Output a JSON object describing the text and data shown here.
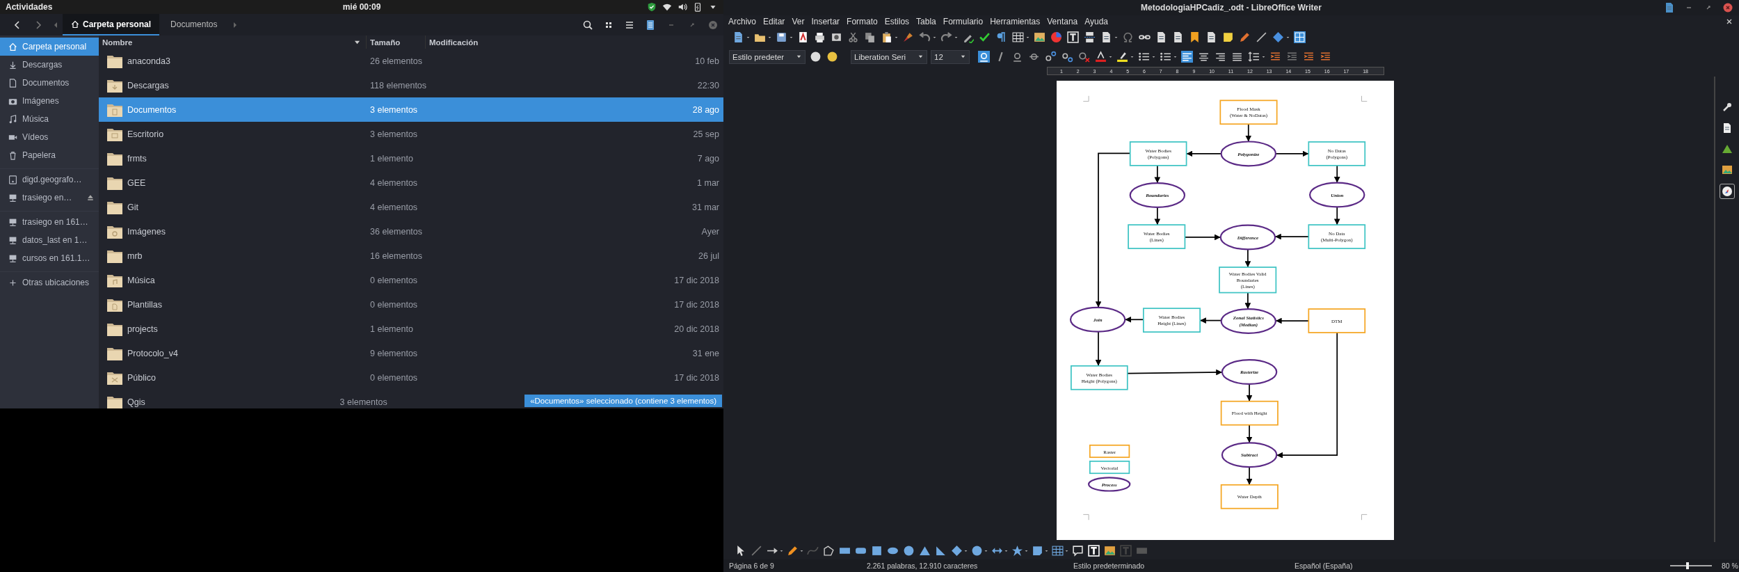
{
  "top_bar": {
    "activities": "Actividades",
    "clock": "mié 00:09"
  },
  "files": {
    "tabs": [
      {
        "label": "Carpeta personal",
        "selected": true
      },
      {
        "label": "Documentos",
        "selected": false
      }
    ],
    "sidebar": [
      {
        "items": [
          {
            "label": "Carpeta personal",
            "selected": true,
            "eject": false
          },
          {
            "label": "Descargas",
            "selected": false,
            "eject": false
          },
          {
            "label": "Documentos",
            "selected": false,
            "eject": false
          },
          {
            "label": "Imágenes",
            "selected": false,
            "eject": false
          },
          {
            "label": "Música",
            "selected": false,
            "eject": false
          },
          {
            "label": "Vídeos",
            "selected": false,
            "eject": false
          },
          {
            "label": "Papelera",
            "selected": false,
            "eject": false
          }
        ]
      },
      {
        "items": [
          {
            "label": "digd.geografo…",
            "selected": false,
            "eject": false
          },
          {
            "label": "trasiego en…",
            "selected": false,
            "eject": true
          }
        ]
      },
      {
        "items": [
          {
            "label": "trasiego en 161…",
            "selected": false,
            "eject": false
          },
          {
            "label": "datos_last en 1…",
            "selected": false,
            "eject": false
          },
          {
            "label": "cursos en 161.1…",
            "selected": false,
            "eject": false
          }
        ]
      },
      {
        "items": [
          {
            "label": "Otras ubicaciones",
            "selected": false,
            "eject": false
          }
        ]
      }
    ],
    "columns": [
      {
        "label": "Nombre",
        "sorted": true
      },
      {
        "label": "Tamaño",
        "sorted": false
      },
      {
        "label": "Modificación",
        "sorted": false
      }
    ],
    "rows": [
      {
        "name": "anaconda3",
        "size": "26 elementos",
        "modified": "10 feb",
        "selected": false
      },
      {
        "name": "Descargas",
        "size": "118 elementos",
        "modified": "22:30",
        "selected": false
      },
      {
        "name": "Documentos",
        "size": "3 elementos",
        "modified": "28 ago",
        "selected": true
      },
      {
        "name": "Escritorio",
        "size": "3 elementos",
        "modified": "25 sep",
        "selected": false
      },
      {
        "name": "frmts",
        "size": "1 elemento",
        "modified": "7 ago",
        "selected": false
      },
      {
        "name": "GEE",
        "size": "4 elementos",
        "modified": "1 mar",
        "selected": false
      },
      {
        "name": "Git",
        "size": "4 elementos",
        "modified": "31 mar",
        "selected": false
      },
      {
        "name": "Imágenes",
        "size": "36 elementos",
        "modified": "Ayer",
        "selected": false
      },
      {
        "name": "mrb",
        "size": "16 elementos",
        "modified": "26 jul",
        "selected": false
      },
      {
        "name": "Música",
        "size": "0 elementos",
        "modified": "17 dic 2018",
        "selected": false
      },
      {
        "name": "Plantillas",
        "size": "0 elementos",
        "modified": "17 dic 2018",
        "selected": false
      },
      {
        "name": "projects",
        "size": "1 elemento",
        "modified": "20 dic 2018",
        "selected": false
      },
      {
        "name": "Protocolo_v4",
        "size": "9 elementos",
        "modified": "31 ene",
        "selected": false
      },
      {
        "name": "Público",
        "size": "0 elementos",
        "modified": "17 dic 2018",
        "selected": false
      },
      {
        "name": "Qgis",
        "size": "3 elementos",
        "selected": false
      }
    ],
    "status": "«Documentos» seleccionado  (contiene 3 elementos)"
  },
  "writer": {
    "title": "MetodologiaHPCadiz_.odt - LibreOffice Writer",
    "menu": [
      "Archivo",
      "Editar",
      "Ver",
      "Insertar",
      "Formato",
      "Estilos",
      "Tabla",
      "Formulario",
      "Herramientas",
      "Ventana",
      "Ayuda"
    ],
    "format_bar": {
      "paragraph_style": "Estilo predeter",
      "font": "Liberation Seri",
      "size": "12"
    },
    "ruler": [
      "1",
      "2",
      "3",
      "4",
      "5",
      "6",
      "7",
      "8",
      "9",
      "10",
      "11",
      "12",
      "13",
      "14",
      "15",
      "16",
      "17",
      "18"
    ],
    "diagram": {
      "nodes": [
        {
          "kind": "raster",
          "lines": [
            "Flood Mask",
            "(Water & NoDatas)"
          ]
        },
        {
          "kind": "vector",
          "lines": [
            "Water Bodies",
            "(Polygons)"
          ]
        },
        {
          "kind": "process",
          "lines": [
            "Polygonize"
          ]
        },
        {
          "kind": "vector",
          "lines": [
            "No Datas",
            "(Polygons)"
          ]
        },
        {
          "kind": "process",
          "lines": [
            "Boundaries"
          ]
        },
        {
          "kind": "process",
          "lines": [
            "Union"
          ]
        },
        {
          "kind": "vector",
          "lines": [
            "Water Bodies",
            "(Lines)"
          ]
        },
        {
          "kind": "process",
          "lines": [
            "Difference"
          ]
        },
        {
          "kind": "vector",
          "lines": [
            "No Data",
            "(Multi-Polygon)"
          ]
        },
        {
          "kind": "vector",
          "lines": [
            "Water Bodies Valid",
            "Boundaries",
            "(Lines)"
          ]
        },
        {
          "kind": "process",
          "lines": [
            "Join"
          ]
        },
        {
          "kind": "vector",
          "lines": [
            "Water Bodies",
            "Height (Lines)"
          ]
        },
        {
          "kind": "process",
          "lines": [
            "Zonal Statistics",
            "(Median)"
          ]
        },
        {
          "kind": "raster",
          "lines": [
            "DTM"
          ]
        },
        {
          "kind": "vector",
          "lines": [
            "Water Bodies",
            "Height (Polygons)"
          ]
        },
        {
          "kind": "process",
          "lines": [
            "Rasterize"
          ]
        },
        {
          "kind": "raster",
          "lines": [
            "Flood with Height"
          ]
        },
        {
          "kind": "process",
          "lines": [
            "Subtract"
          ]
        },
        {
          "kind": "raster",
          "lines": [
            "Water Depth"
          ]
        }
      ],
      "legend": [
        {
          "kind": "raster",
          "label": "Raster"
        },
        {
          "kind": "vector",
          "label": "Vectorial"
        },
        {
          "kind": "process",
          "label": "Process"
        }
      ]
    },
    "status_bar": {
      "page": "Página 6 de 9",
      "words": "2.261 palabras, 12.910 caracteres",
      "style": "Estilo predeterminado",
      "language": "Español (España)",
      "zoom": "80 %",
      "zoom_slider": {
        "level": 0.42
      }
    }
  }
}
